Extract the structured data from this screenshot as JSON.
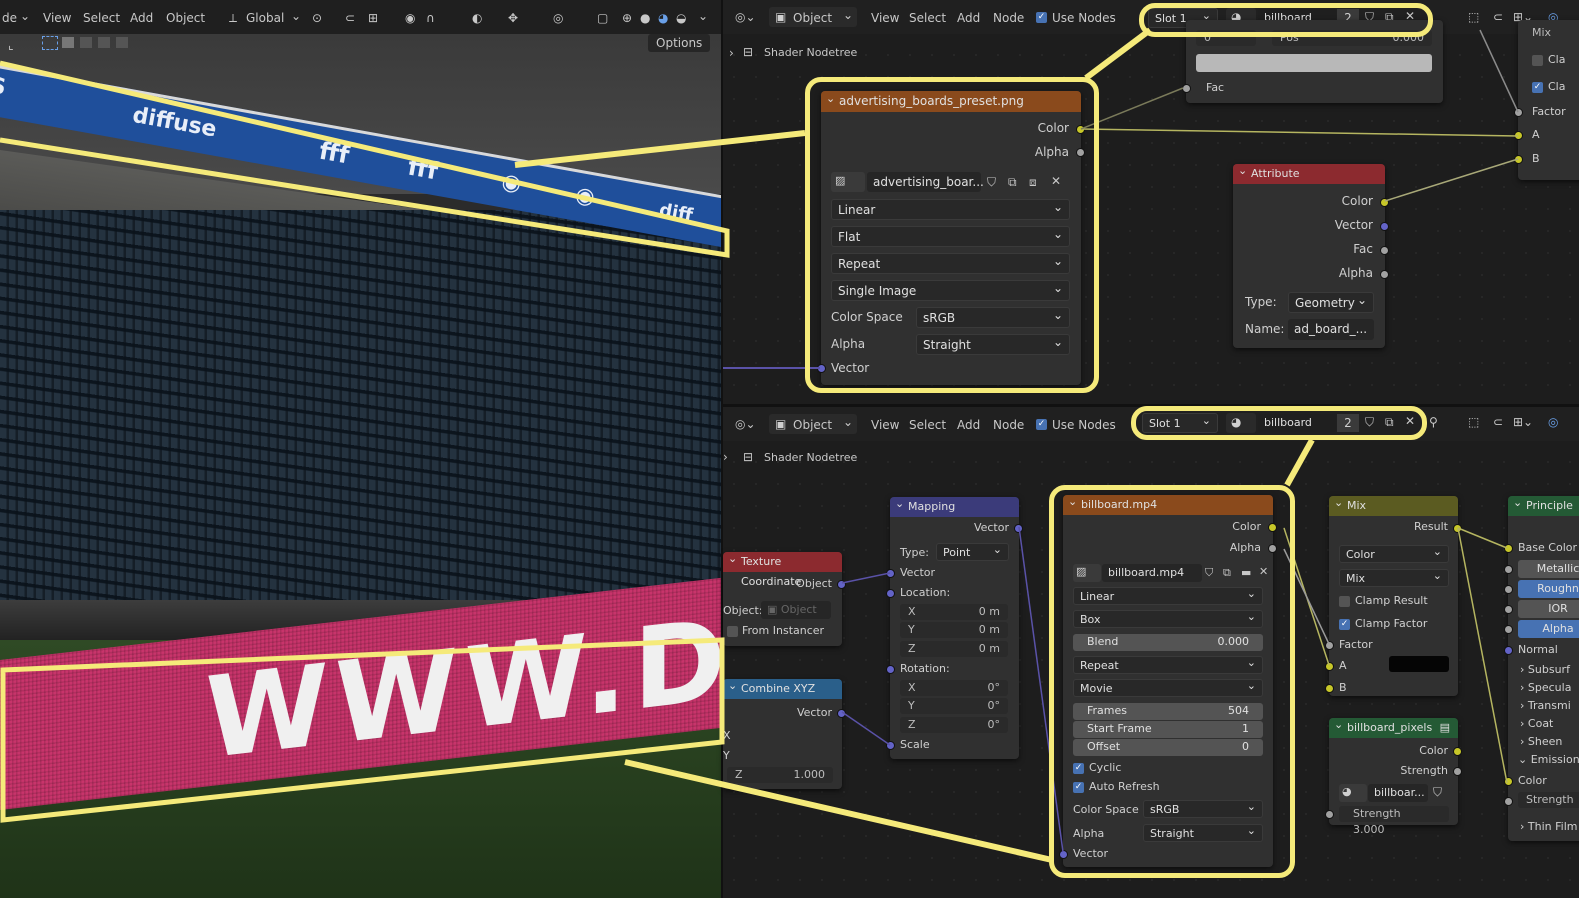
{
  "viewport": {
    "menus": [
      "de",
      "View",
      "Select",
      "Add",
      "Object"
    ],
    "orientation": "Global",
    "options_label": "Options",
    "board_top_texts": [
      "DS",
      "diffuse",
      "fff",
      "fff",
      "diff"
    ],
    "board_bottom_text": "WWW.DIFFUSE.ST"
  },
  "top_editor": {
    "mode": "Object",
    "menus": [
      "View",
      "Select",
      "Add",
      "Node"
    ],
    "use_nodes_label": "Use Nodes",
    "slot": "Slot 1",
    "material": "billboard",
    "user_count": "2",
    "breadcrumb": "Shader Nodetree",
    "partial_node": {
      "fac_label": "Fac",
      "left_label": "0",
      "mid_label": "Pos",
      "right_value": "0.000"
    },
    "mix_partial": {
      "title": "Mix",
      "clamp1": "Cla",
      "clamp2": "Cla",
      "factor": "Factor",
      "a": "A",
      "b": "B"
    },
    "image_node": {
      "title": "advertising_boards_preset.png",
      "out_color": "Color",
      "out_alpha": "Alpha",
      "image_name": "advertising_boar...",
      "interpolation": "Linear",
      "projection": "Flat",
      "extension": "Repeat",
      "source": "Single Image",
      "color_space_label": "Color Space",
      "color_space": "sRGB",
      "alpha_label": "Alpha",
      "alpha": "Straight",
      "vector_label": "Vector"
    },
    "attribute_node": {
      "title": "Attribute",
      "outputs": [
        "Color",
        "Vector",
        "Fac",
        "Alpha"
      ],
      "type_label": "Type:",
      "type": "Geometry",
      "name_label": "Name:",
      "name": "ad_board_..."
    }
  },
  "bottom_editor": {
    "mode": "Object",
    "menus": [
      "View",
      "Select",
      "Add",
      "Node"
    ],
    "use_nodes_label": "Use Nodes",
    "slot": "Slot 1",
    "material": "billboard",
    "user_count": "2",
    "breadcrumb": "Shader Nodetree",
    "texcoord_node": {
      "title": "Texture Coordinate",
      "out_object": "Object",
      "object_label": "Object:",
      "object_placeholder": "Object",
      "from_instancer": "From Instancer"
    },
    "combine_node": {
      "title": "Combine XYZ",
      "out_vector": "Vector",
      "x": "X",
      "y": "Y",
      "z_label": "Z",
      "z_value": "1.000"
    },
    "mapping_node": {
      "title": "Mapping",
      "out_vector": "Vector",
      "type_label": "Type:",
      "type": "Point",
      "in_vector": "Vector",
      "location_label": "Location:",
      "loc": [
        {
          "axis": "X",
          "value": "0 m"
        },
        {
          "axis": "Y",
          "value": "0 m"
        },
        {
          "axis": "Z",
          "value": "0 m"
        }
      ],
      "rotation_label": "Rotation:",
      "rot": [
        {
          "axis": "X",
          "value": "0°"
        },
        {
          "axis": "Y",
          "value": "0°"
        },
        {
          "axis": "Z",
          "value": "0°"
        }
      ],
      "scale_label": "Scale"
    },
    "movie_node": {
      "title": "billboard.mp4",
      "out_color": "Color",
      "out_alpha": "Alpha",
      "image_name": "billboard.mp4",
      "interpolation": "Linear",
      "projection": "Box",
      "blend_label": "Blend",
      "blend_value": "0.000",
      "extension": "Repeat",
      "source": "Movie",
      "frames_label": "Frames",
      "frames_value": "504",
      "start_label": "Start Frame",
      "start_value": "1",
      "offset_label": "Offset",
      "offset_value": "0",
      "cyclic": "Cyclic",
      "auto_refresh": "Auto Refresh",
      "color_space_label": "Color Space",
      "color_space": "sRGB",
      "alpha_label": "Alpha",
      "alpha": "Straight",
      "vector_label": "Vector"
    },
    "mix_node": {
      "title": "Mix",
      "out_result": "Result",
      "data_type": "Color",
      "blend_type": "Mix",
      "clamp_result": "Clamp Result",
      "clamp_factor": "Clamp Factor",
      "factor": "Factor",
      "a": "A",
      "b": "B"
    },
    "group_node": {
      "title": "billboard_pixels",
      "out_color": "Color",
      "strength_label": "Strength",
      "material_field": "billboar...",
      "strength_field": "Strength",
      "strength_value": "3.000"
    },
    "principled_node": {
      "title": "Principle",
      "items": [
        "Base Color",
        "Metallic",
        "Roughn",
        "IOR",
        "Alpha",
        "Normal",
        "Subsurf",
        "Specula",
        "Transmi",
        "Coat",
        "Sheen",
        "Emission",
        "Color",
        "Strength",
        "Thin Film"
      ]
    }
  },
  "colors": {
    "highlight": "#f5ea7a",
    "texture_header": "#8a4a1c",
    "board_blue": "#1f4f9b",
    "board_pink": "#c8346b"
  }
}
